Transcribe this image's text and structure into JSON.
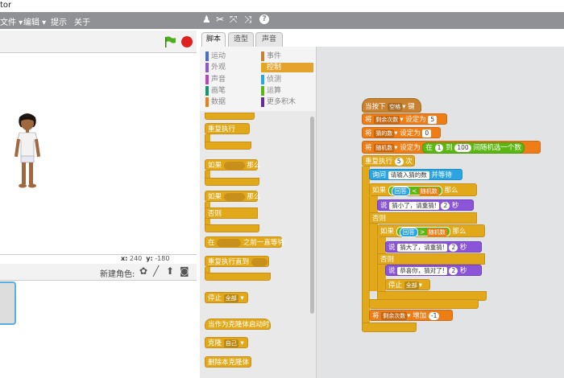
{
  "window": {
    "title": "tor"
  },
  "menubar": {
    "items": [
      "文件 ▾",
      "编辑 ▾",
      "提示",
      "关于"
    ],
    "toolbar_icons": [
      "stamp-icon",
      "cut-icon",
      "grow-icon",
      "shrink-icon",
      "help-icon"
    ],
    "toolbar_glyphs": [
      "♟",
      "✂",
      "⤧",
      "⤨",
      "?"
    ]
  },
  "stage": {
    "coords": {
      "x_label": "x:",
      "x_value": "240",
      "y_label": "y:",
      "y_value": "-180"
    },
    "new_sprite_label": "新建角色:",
    "new_sprite_icons": [
      "paint-sprite-icon",
      "draw-sprite-icon",
      "upload-sprite-icon",
      "camera-icon"
    ],
    "new_sprite_glyphs": [
      "✿",
      "╱",
      "⬆",
      "◙"
    ]
  },
  "tabs": [
    {
      "label": "脚本",
      "active": true
    },
    {
      "label": "造型",
      "active": false
    },
    {
      "label": "声音",
      "active": false
    }
  ],
  "categories": [
    {
      "label": "运动",
      "color": "#4a6cd4",
      "selected": false
    },
    {
      "label": "事件",
      "color": "#c88330",
      "selected": false
    },
    {
      "label": "外观",
      "color": "#8a55d7",
      "selected": false
    },
    {
      "label": "控制",
      "color": "#e1a91a",
      "selected": true
    },
    {
      "label": "声音",
      "color": "#bb42c3",
      "selected": false
    },
    {
      "label": "侦测",
      "color": "#2ca5e2",
      "selected": false
    },
    {
      "label": "画笔",
      "color": "#0e9a6c",
      "selected": false
    },
    {
      "label": "运算",
      "color": "#5cb712",
      "selected": false
    },
    {
      "label": "数据",
      "color": "#ee7d16",
      "selected": false
    },
    {
      "label": "更多积木",
      "color": "#632d99",
      "selected": false
    }
  ],
  "palette": {
    "repeat_forever": "重复执行",
    "if_then_if": "如果",
    "if_then_then": "那么",
    "if_else_if": "如果",
    "if_else_then": "那么",
    "if_else_else": "否则",
    "wait_until_in": "在",
    "wait_until_text": "之前一直等待",
    "repeat_until": "重复执行直到",
    "stop": "停止",
    "stop_option": "全部",
    "clone_start": "当作为克隆体启动时",
    "clone": "克隆",
    "clone_option": "自己",
    "delete_clone": "删除本克隆体"
  },
  "script": {
    "hat": {
      "text": "当按下",
      "key": "空格",
      "suffix": "键"
    },
    "set1": {
      "prefix": "将",
      "var": "剩余次数",
      "mid": "设定为",
      "value": "5"
    },
    "set2": {
      "prefix": "将",
      "var": "猜的数",
      "mid": "设定为",
      "value": "0"
    },
    "set3": {
      "prefix": "将",
      "var": "随机数",
      "mid": "设定为",
      "op_a": "在",
      "from": "1",
      "op_b": "到",
      "to": "100",
      "op_c": "间随机选一个数"
    },
    "repeat": {
      "prefix": "重复执行",
      "count": "5",
      "suffix": "次"
    },
    "ask": {
      "prefix": "询问",
      "question": "请输入猜的数",
      "suffix": "并等待"
    },
    "if1": {
      "prefix": "如果",
      "left": "回答",
      "op": "<",
      "right": "随机数",
      "then": "那么"
    },
    "say1": {
      "prefix": "说",
      "text": "猜小了，请重猜!",
      "secs": "2",
      "unit": "秒"
    },
    "else1": "否则",
    "if2": {
      "prefix": "如果",
      "left": "回答",
      "op": ">",
      "right": "随机数",
      "then": "那么"
    },
    "say2": {
      "prefix": "说",
      "text": "猜大了，请重猜!",
      "secs": "2",
      "unit": "秒"
    },
    "else2": "否则",
    "say3": {
      "prefix": "说",
      "text": "恭喜你，猜对了!",
      "secs": "2",
      "unit": "秒"
    },
    "stop": {
      "prefix": "停止",
      "option": "全部"
    },
    "change": {
      "prefix": "将",
      "var": "剩余次数",
      "mid": "增加",
      "value": "-1"
    }
  }
}
